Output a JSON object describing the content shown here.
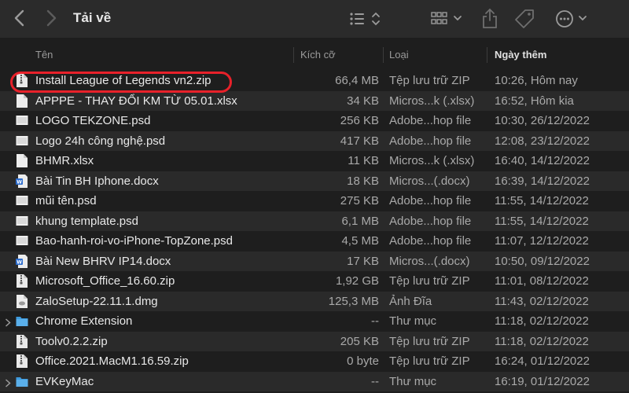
{
  "window": {
    "title": "Tải về"
  },
  "columns": {
    "name": "Tên",
    "size": "Kích cỡ",
    "kind": "Loại",
    "date": "Ngày thêm"
  },
  "files": [
    {
      "name": "Install League of Legends vn2.zip",
      "size": "66,4 MB",
      "kind": "Tệp lưu trữ ZIP",
      "date": "10:26, Hôm nay",
      "icon": "zip-file-icon"
    },
    {
      "name": "APPPE - THAY ĐỔI KM TỪ 05.01.xlsx",
      "size": "34 KB",
      "kind": "Micros...k (.xlsx)",
      "date": "16:52, Hôm kia",
      "icon": "document-file-icon"
    },
    {
      "name": "LOGO TEKZONE.psd",
      "size": "256 KB",
      "kind": "Adobe...hop file",
      "date": "10:30, 26/12/2022",
      "icon": "image-file-icon"
    },
    {
      "name": "Logo 24h công nghệ.psd",
      "size": "417 KB",
      "kind": "Adobe...hop file",
      "date": "12:08, 23/12/2022",
      "icon": "image-file-icon"
    },
    {
      "name": "BHMR.xlsx",
      "size": "11 KB",
      "kind": "Micros...k (.xlsx)",
      "date": "16:40, 14/12/2022",
      "icon": "document-file-icon"
    },
    {
      "name": "Bài Tin BH Iphone.docx",
      "size": "18 KB",
      "kind": "Micros...(.docx)",
      "date": "16:39, 14/12/2022",
      "icon": "word-document-icon"
    },
    {
      "name": "mũi tên.psd",
      "size": "275 KB",
      "kind": "Adobe...hop file",
      "date": "11:55, 14/12/2022",
      "icon": "image-file-icon"
    },
    {
      "name": "khung template.psd",
      "size": "6,1 MB",
      "kind": "Adobe...hop file",
      "date": "11:55, 14/12/2022",
      "icon": "image-file-icon"
    },
    {
      "name": "Bao-hanh-roi-vo-iPhone-TopZone.psd",
      "size": "4,5 MB",
      "kind": "Adobe...hop file",
      "date": "11:07, 12/12/2022",
      "icon": "image-file-icon"
    },
    {
      "name": "Bài New BHRV IP14.docx",
      "size": "17 KB",
      "kind": "Micros...(.docx)",
      "date": "10:50, 09/12/2022",
      "icon": "word-document-icon"
    },
    {
      "name": "Microsoft_Office_16.60.zip",
      "size": "1,92 GB",
      "kind": "Tệp lưu trữ ZIP",
      "date": "11:01, 08/12/2022",
      "icon": "zip-file-icon"
    },
    {
      "name": "ZaloSetup-22.11.1.dmg",
      "size": "125,3 MB",
      "kind": "Ảnh Đĩa",
      "date": "11:43, 02/12/2022",
      "icon": "disk-image-icon"
    },
    {
      "name": "Chrome Extension",
      "size": "--",
      "kind": "Thư mục",
      "date": "11:18, 02/12/2022",
      "icon": "folder-icon"
    },
    {
      "name": "Toolv0.2.2.zip",
      "size": "205 KB",
      "kind": "Tệp lưu trữ ZIP",
      "date": "11:18, 02/12/2022",
      "icon": "zip-file-icon"
    },
    {
      "name": "Office.2021.MacM1.16.59.zip",
      "size": "0 byte",
      "kind": "Tệp lưu trữ ZIP",
      "date": "16:24, 01/12/2022",
      "icon": "zip-file-icon"
    },
    {
      "name": "EVKeyMac",
      "size": "--",
      "kind": "Thư mục",
      "date": "16:19, 01/12/2022",
      "icon": "folder-icon"
    }
  ],
  "colors": {
    "highlight": "#e8212a",
    "folder": "#3e9bde",
    "word": "#2f6fcf"
  }
}
